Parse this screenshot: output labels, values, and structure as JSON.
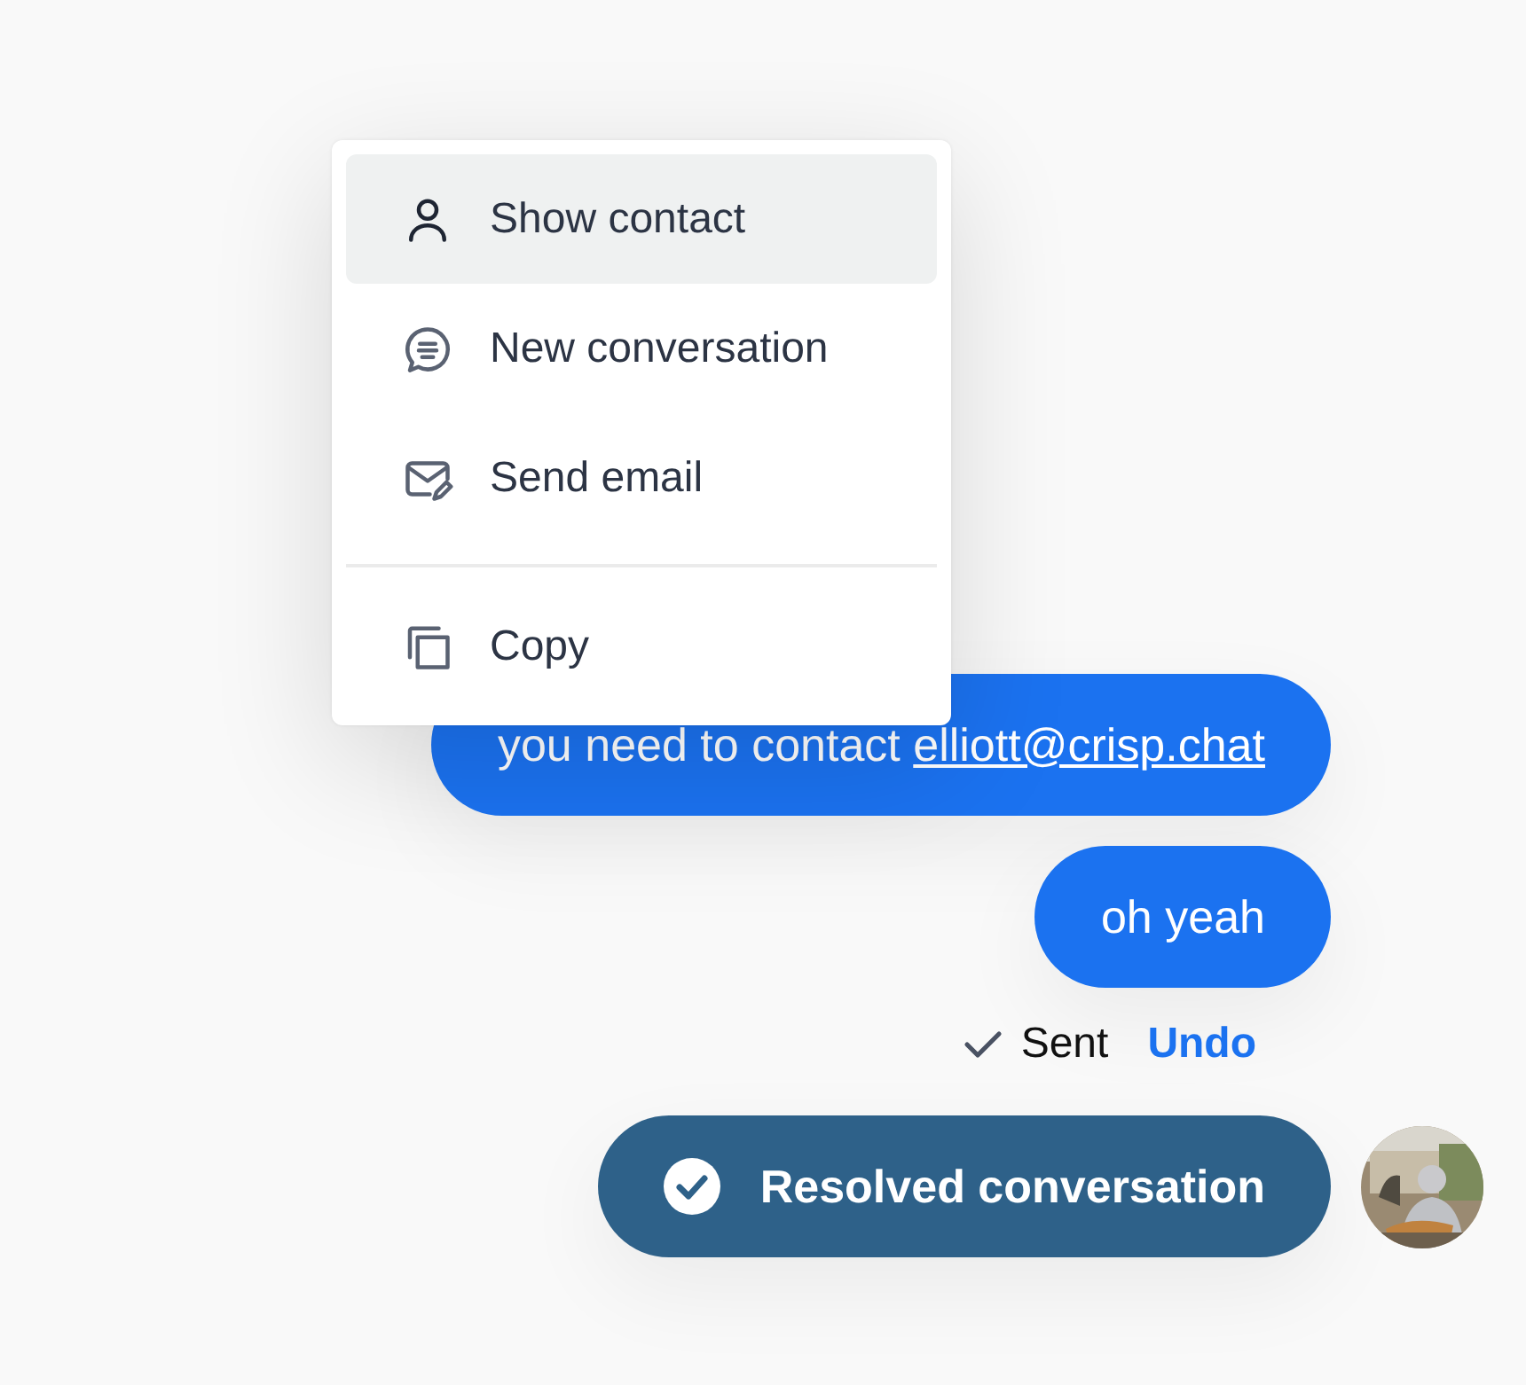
{
  "context_menu": {
    "sections": [
      [
        {
          "kind": "person",
          "label": "Show contact",
          "selected": true
        },
        {
          "kind": "chat",
          "label": "New conversation",
          "selected": false
        },
        {
          "kind": "mail",
          "label": "Send email",
          "selected": false
        }
      ],
      [
        {
          "kind": "copy",
          "label": "Copy",
          "selected": false
        }
      ]
    ]
  },
  "messages": [
    {
      "kind": "text",
      "text": "you need to contact ",
      "link": "elliott@crisp.chat"
    },
    {
      "kind": "text",
      "text": "oh yeah"
    },
    {
      "kind": "status",
      "status": "Sent",
      "action": "Undo"
    },
    {
      "kind": "event",
      "text": "Resolved conversation"
    }
  ]
}
